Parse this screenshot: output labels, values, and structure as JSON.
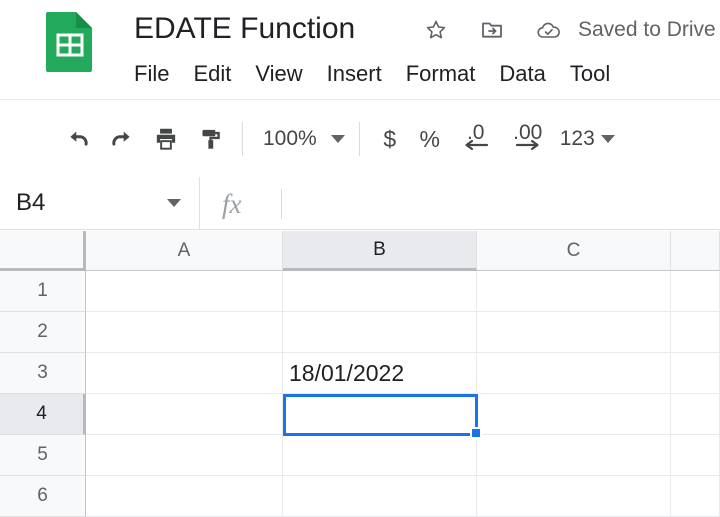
{
  "app": {
    "name": "Google Sheets",
    "logo_color": "#34a853"
  },
  "header": {
    "title": "EDATE Function",
    "save_status": "Saved to Drive",
    "icons": {
      "star": "star-icon",
      "move_to_folder": "move-to-folder-icon",
      "cloud_saved": "cloud-saved-icon"
    }
  },
  "menubar": {
    "items": [
      {
        "label": "File"
      },
      {
        "label": "Edit"
      },
      {
        "label": "View"
      },
      {
        "label": "Insert"
      },
      {
        "label": "Format"
      },
      {
        "label": "Data"
      },
      {
        "label": "Tool"
      }
    ]
  },
  "toolbar": {
    "undo": "undo-icon",
    "redo": "redo-icon",
    "print": "print-icon",
    "paint_format": "paint-format-icon",
    "zoom_value": "100%",
    "currency": "$",
    "percent": "%",
    "decrease_decimal": ".0",
    "increase_decimal": ".00",
    "number_format": "123"
  },
  "formula_bar": {
    "name_box_value": "B4",
    "fx_label": "fx",
    "formula_value": "",
    "formula_placeholder": ""
  },
  "grid": {
    "columns": [
      {
        "label": "A",
        "selected": false
      },
      {
        "label": "B",
        "selected": true
      },
      {
        "label": "C",
        "selected": false
      },
      {
        "label": "",
        "selected": false
      }
    ],
    "rows": [
      {
        "label": "1",
        "selected": false
      },
      {
        "label": "2",
        "selected": false
      },
      {
        "label": "3",
        "selected": false
      },
      {
        "label": "4",
        "selected": true
      },
      {
        "label": "5",
        "selected": false
      },
      {
        "label": "6",
        "selected": false
      }
    ],
    "cells": {
      "B3": "18/01/2022",
      "B4": ""
    },
    "active_cell": "B4",
    "selection_color": "#1a73e8"
  }
}
